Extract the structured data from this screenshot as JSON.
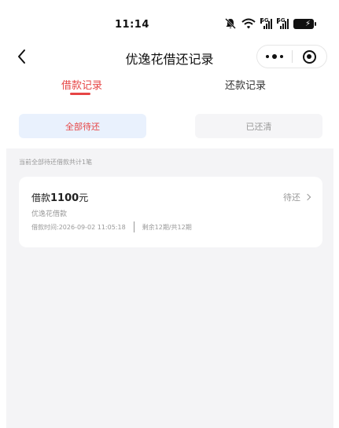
{
  "status_bar": {
    "time": "11:14",
    "network_label_1": "5G",
    "network_label_2": "5G",
    "icons": [
      "mute-icon",
      "wifi-icon",
      "signal-icon",
      "signal-icon",
      "battery-icon"
    ]
  },
  "nav": {
    "title": "优逸花借还记录",
    "back_icon": "chevron-left-icon",
    "more_icon": "more-dots-icon",
    "close_icon": "target-circle-icon"
  },
  "tabs": [
    {
      "label": "借款记录",
      "active": true
    },
    {
      "label": "还款记录",
      "active": false
    }
  ],
  "filters": [
    {
      "label": "全部待还",
      "active": true
    },
    {
      "label": "已还清",
      "active": false
    }
  ],
  "summary_text": "当前全部待还借款共计1笔",
  "loans": [
    {
      "title_prefix": "借款",
      "amount": "1100",
      "unit": "元",
      "status": "待还",
      "product": "优逸花借款",
      "borrow_time": "借款时间:2026-09-02 11:05:18",
      "remaining": "剩余12期/共12期"
    }
  ],
  "colors": {
    "accent": "#e64545",
    "active_pill_bg": "#e9f1fd",
    "inactive_pill_bg": "#f5f5f7",
    "content_bg": "#f4f4f6"
  }
}
